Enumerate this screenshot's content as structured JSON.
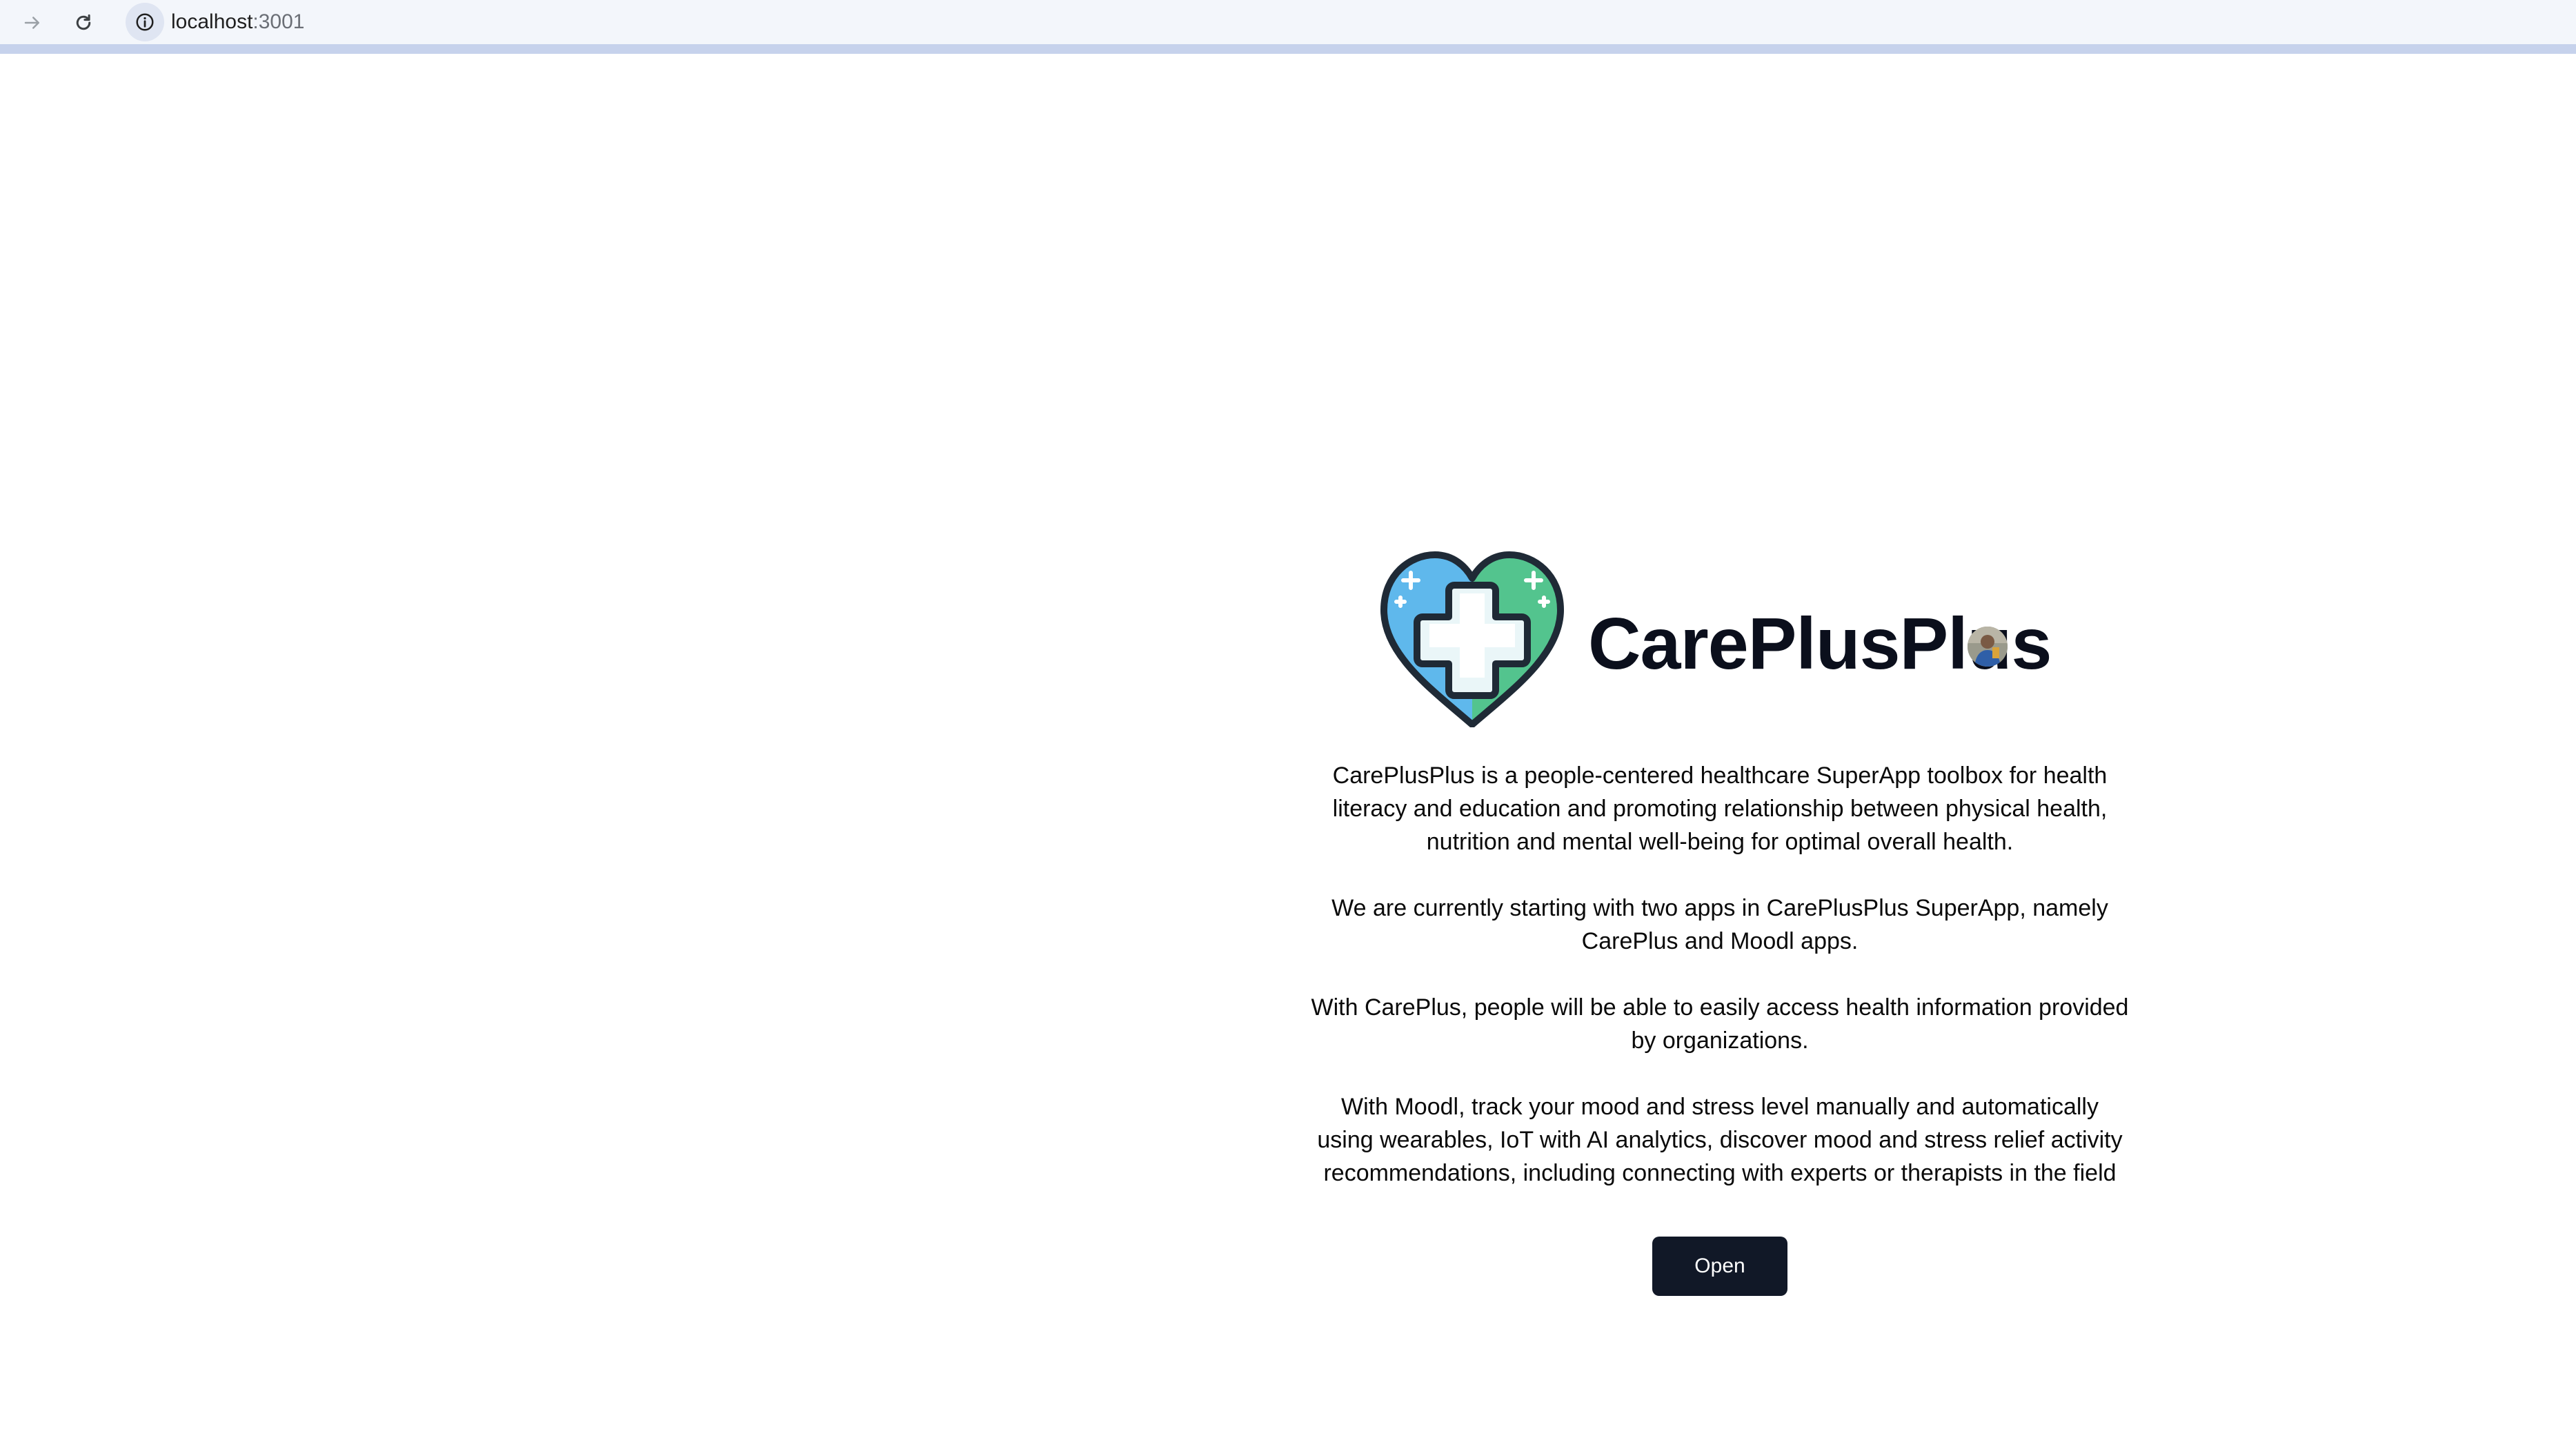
{
  "browser": {
    "url_host": "localhost",
    "url_port": ":3001",
    "icons": {
      "forward": "arrow-right-icon",
      "reload": "reload-icon",
      "site_info": "info-icon"
    }
  },
  "page": {
    "brand_name": "CarePlusPlus",
    "paragraphs": [
      "CarePlusPlus is a people-centered healthcare SuperApp toolbox for health literacy and education and promoting relationship between physical health, nutrition and mental well-being for optimal overall health.",
      "We are currently starting with two apps in CarePlusPlus SuperApp, namely CarePlus and Moodl apps.",
      "With CarePlus, people will be able to easily access health information provided by organizations.",
      "With Moodl, track your mood and stress level manually and automatically using wearables, IoT with AI analytics, discover mood and stress relief activity recommendations, including connecting with experts or therapists in the field"
    ],
    "open_button_label": "Open",
    "colors": {
      "heart_left": "#5fb8ec",
      "heart_right": "#53c48e",
      "outline": "#1f2a36",
      "button_bg": "#111827"
    }
  }
}
